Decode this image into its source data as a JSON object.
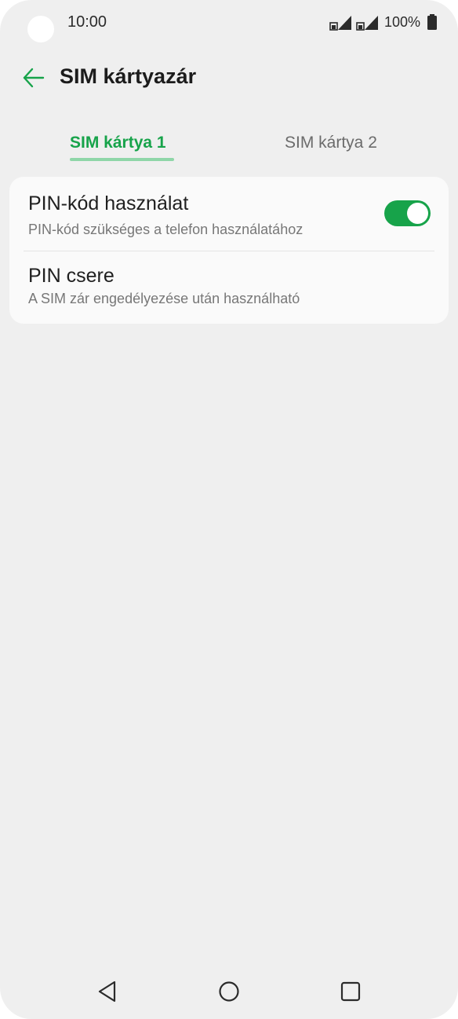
{
  "status_bar": {
    "time": "10:00",
    "battery": "100%",
    "icons": [
      "signal-sim1-icon",
      "signal-sim2-icon",
      "battery-icon"
    ]
  },
  "header": {
    "title": "SIM kártyazár",
    "back_icon": "arrow-left-icon",
    "accent_color": "#17a34a"
  },
  "tabs": [
    {
      "label": "SIM kártya 1",
      "selected": true
    },
    {
      "label": "SIM kártya 2",
      "selected": false
    }
  ],
  "settings": {
    "pin_usage": {
      "title": "PIN-kód használat",
      "subtitle": "PIN-kód szükséges a telefon használatához",
      "enabled": true
    },
    "pin_change": {
      "title": "PIN csere",
      "subtitle": "A SIM zár engedélyezése után használható"
    }
  },
  "navbar": {
    "icons": [
      "nav-back-icon",
      "nav-home-icon",
      "nav-recent-icon"
    ]
  }
}
